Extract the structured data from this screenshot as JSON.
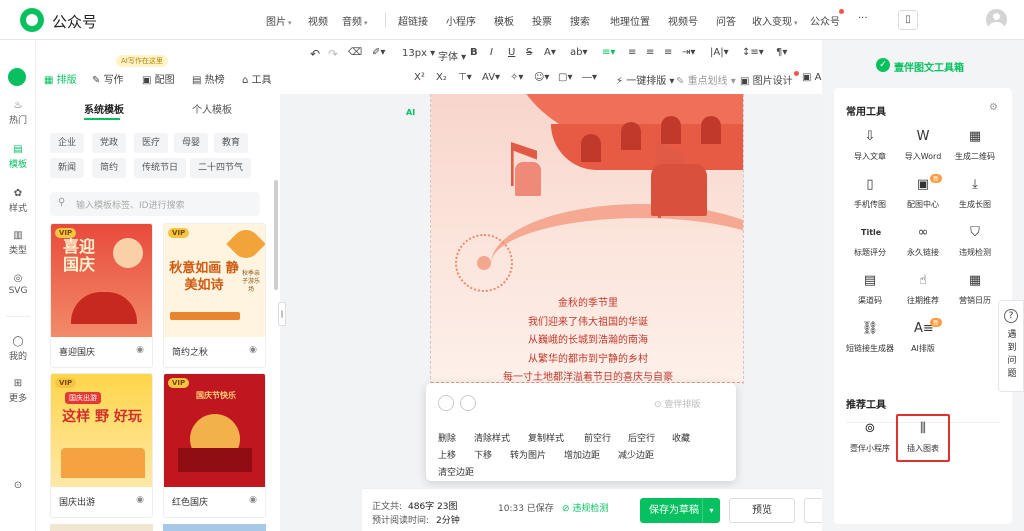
{
  "app": {
    "title": "公众号"
  },
  "nav": {
    "items": [
      "图片",
      "视频",
      "音频",
      "超链接",
      "小程序",
      "模板",
      "投票",
      "搜索",
      "地理位置",
      "视频号",
      "问答",
      "收入变现",
      "公众号",
      "···"
    ]
  },
  "rail": {
    "items": [
      {
        "label": "热门",
        "icon": "fire-icon"
      },
      {
        "label": "模板",
        "icon": "template-icon"
      },
      {
        "label": "样式",
        "icon": "style-icon"
      },
      {
        "label": "类型",
        "icon": "type-icon"
      },
      {
        "label": "SVG",
        "icon": "svg-icon"
      },
      {
        "label": "我的",
        "icon": "user-icon"
      },
      {
        "label": "更多",
        "icon": "more-icon"
      }
    ]
  },
  "panel": {
    "tabs": [
      "排版",
      "写作",
      "配图",
      "热榜",
      "工具"
    ],
    "ai_badge": "AI写作在这里",
    "subtabs": [
      "系统模板",
      "个人模板"
    ],
    "tags": [
      "企业",
      "党政",
      "医疗",
      "母婴",
      "教育",
      "新闻",
      "简约",
      "传统节日",
      "二十四节气"
    ],
    "search_placeholder": "输入模板标签、ID进行搜索",
    "vip": "VIP",
    "cards": [
      {
        "name": "喜迎国庆",
        "title": "喜迎国庆"
      },
      {
        "name": "简约之秋",
        "title": "秋意如画 静美如诗",
        "sub": "秋季亲子游乐场"
      },
      {
        "name": "国庆出游",
        "title": "这样 野 好玩",
        "sub": "国庆出游"
      },
      {
        "name": "红色国庆",
        "title": "国庆节快乐"
      }
    ]
  },
  "toolbar": {
    "font_size": "13px",
    "font_family": "字体",
    "one_key": "一键排版",
    "focus": "重点划线",
    "image_design": "图片设计",
    "ai": "AI"
  },
  "doc": {
    "poem": [
      "金秋的季节里",
      "我们迎来了伟大祖国的华诞",
      "从巍峨的长城到浩瀚的南海",
      "从繁华的都市到宁静的乡村",
      "每一寸土地都洋溢着节日的喜庆与自豪"
    ]
  },
  "context_menu": {
    "brand": "壹伴排版",
    "items": [
      "删除",
      "清除样式",
      "复制样式",
      "前空行",
      "后空行",
      "收藏",
      "上移",
      "下移",
      "转为图片",
      "增加边距",
      "减少边距",
      "清空边距"
    ]
  },
  "status": {
    "word_label": "正文共:",
    "word_count": "486字 23图",
    "read_label": "预计阅读时间:",
    "read_time": "2分钟",
    "saved": "10:33 已保存",
    "check": "违规检测",
    "save_button": "保存为草稿",
    "preview_button": "预览"
  },
  "tools": {
    "title": "壹伴图文工具箱",
    "common_label": "常用工具",
    "common": [
      {
        "label": "导入文章",
        "icon": "import-icon"
      },
      {
        "label": "导入Word",
        "icon": "word-icon"
      },
      {
        "label": "生成二维码",
        "icon": "qrcode-icon"
      },
      {
        "label": "手机传图",
        "icon": "phone-icon"
      },
      {
        "label": "配图中心",
        "icon": "image-icon",
        "badge": "新"
      },
      {
        "label": "生成长图",
        "icon": "longimage-icon"
      },
      {
        "label": "标题评分",
        "icon": "title-icon"
      },
      {
        "label": "永久链接",
        "icon": "link-icon"
      },
      {
        "label": "违规检测",
        "icon": "shield-icon"
      },
      {
        "label": "渠道码",
        "icon": "barcode-icon"
      },
      {
        "label": "往期推荐",
        "icon": "thumbsup-icon"
      },
      {
        "label": "营销日历",
        "icon": "calendar-icon"
      },
      {
        "label": "短链接生成器",
        "icon": "shortlink-icon"
      },
      {
        "label": "AI排版",
        "icon": "ai-layout-icon",
        "badge": "新"
      }
    ],
    "rec_label": "推荐工具",
    "rec": [
      {
        "label": "壹伴小程序",
        "icon": "miniprogram-icon"
      },
      {
        "label": "插入图表",
        "icon": "chart-icon"
      }
    ]
  },
  "help": {
    "label": "遇到问题"
  }
}
